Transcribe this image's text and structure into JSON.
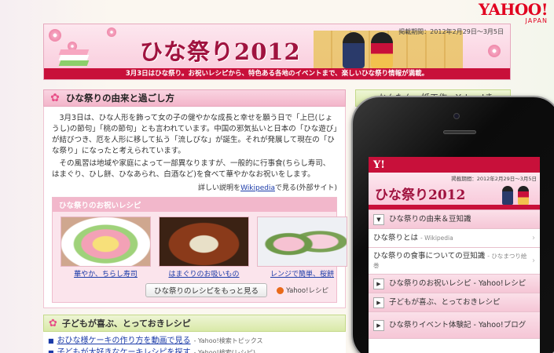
{
  "logo": {
    "main": "YAHOO!",
    "sub": "JAPAN"
  },
  "banner": {
    "period": "掲載期間：2012年2月29日〜3月5日",
    "title": "ひな祭り",
    "year": "2012",
    "strip": "3月3日はひな祭り。お祝いレシピから、特色ある各地のイベントまで、楽しいひな祭り情報が満載。"
  },
  "origin": {
    "heading": "ひな祭りの由来と過ごし方",
    "paragraph1": "3月3日は、ひな人形を飾って女の子の健やかな成長と幸せを願う日で「上巳(じょうし)の節句」「桃の節句」とも言われています。中国の邪気払いと日本の「ひな遊び」が結びつき、厄を人形に移して払う「流しびな」が誕生。それが発展して現在の「ひな祭り」になったと考えられています。",
    "paragraph2": "その風習は地域や家庭によって一部異なりますが、一般的に行事食(ちらし寿司、はまぐり、ひし餅、ひなあられ、白酒など)を食べて華やかなお祝いをします。",
    "wiki_prefix": "詳しい説明を",
    "wiki_link": "Wikipedia",
    "wiki_suffix": "で見る(外部サイト)"
  },
  "recipes": {
    "heading": "ひな祭りのお祝いレシピ",
    "items": [
      {
        "label": "華やか、ちらし寿司"
      },
      {
        "label": "はまぐりのお吸いもの"
      },
      {
        "label": "レンジで簡単、桜餅"
      }
    ],
    "more_button": "ひな祭りのレシピをもっと見る",
    "brand": "Yahoo!レシピ"
  },
  "kids": {
    "heading": "子どもが喜ぶ、とっておきレシピ",
    "links": [
      {
        "text": "おひな様ケーキの作り方を動画で見る",
        "source": "- Yahoo!検索トピックス"
      },
      {
        "text": "子どもが大好きなケーキレシピを探す",
        "source": "- Yahoo!検索(レシピ)"
      }
    ]
  },
  "right_column": {
    "heading": "かんたん、紙工作 - Yahoo!きっず"
  },
  "mobile": {
    "logo": "Y!",
    "period": "掲載期間：2012年2月29日〜3月5日",
    "title": "ひな祭り2012",
    "items": [
      {
        "label": "ひな祭りの由来＆豆知識",
        "style": "pink",
        "icon": "▼",
        "source": ""
      },
      {
        "label": "ひな祭りとは",
        "style": "white",
        "icon": "",
        "source": "- Wikipedia"
      },
      {
        "label": "ひな祭りの食事についての豆知識",
        "style": "white",
        "icon": "",
        "source": "- ひなまつり絵巻"
      },
      {
        "label": "ひな祭りのお祝いレシピ - Yahoo!レシピ",
        "style": "pink",
        "icon": "▶",
        "source": ""
      },
      {
        "label": "子どもが喜ぶ、とっておきレシピ",
        "style": "pink",
        "icon": "▶",
        "source": ""
      },
      {
        "label": "ひな祭りイベント体験記 - Yahoo!ブログ",
        "style": "pink",
        "icon": "▶",
        "source": ""
      }
    ]
  },
  "colors": {
    "accent_red": "#c8103a",
    "pink": "#f3b5ca",
    "green": "#d9e9a8",
    "link": "#1a3aa8"
  }
}
